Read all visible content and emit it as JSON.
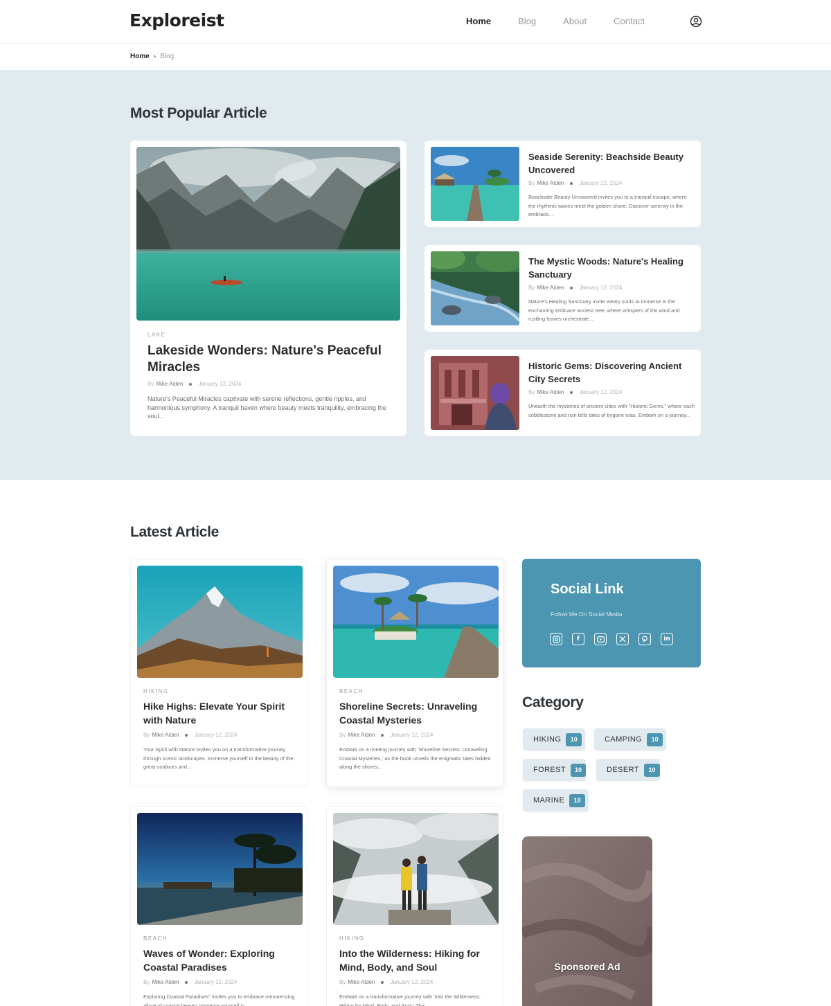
{
  "brand": {
    "logo": "Exploreist"
  },
  "nav": {
    "items": [
      "Home",
      "Blog",
      "About",
      "Contact"
    ],
    "active": "Home"
  },
  "header": {
    "user_icon": "user-circle-icon"
  },
  "breadcrumb": {
    "home": "Home",
    "separator": "›",
    "current": "Blog"
  },
  "popular": {
    "heading": "Most Popular Article",
    "featured": {
      "tag": "LAKE",
      "title": "Lakeside Wonders: Nature's Peaceful Miracles",
      "by": "By",
      "author": "Mike Aiden",
      "date": "January 12, 2024",
      "excerpt": "Nature's Peaceful Miracles captivate with serene reflections, gentle ripples, and harmonious symphony. A tranquil haven where beauty meets tranquility, embracing the soul..."
    },
    "side": [
      {
        "title": "Seaside Serenity: Beachside Beauty Uncovered",
        "by": "By",
        "author": "Mike Aiden",
        "date": "January 12, 2024",
        "excerpt": "Beachside Beauty Uncovered invites you to a tranquil escape, where the rhythmic waves meet the golden shore. Discover serenity in the embrace..."
      },
      {
        "title": "The Mystic Woods: Nature's Healing Sanctuary",
        "by": "By",
        "author": "Mike Aiden",
        "date": "January 12, 2024",
        "excerpt": "Nature's Healing Sanctuary invite weary souls to immerse in the enchanting embrace ancient tree, where whispers of the wind and rustling leaves orchestrate..."
      },
      {
        "title": "Historic Gems: Discovering Ancient City Secrets",
        "by": "By",
        "author": "Mike Aiden",
        "date": "January 12, 2024",
        "excerpt": "Unearth the mysteries of ancient cities with \"Historic Gems,\" where each cobblestone and ruin tells tales of bygone eras. Embark on a journey..."
      }
    ]
  },
  "latest": {
    "heading": "Latest Article",
    "articles": [
      {
        "tag": "HIKING",
        "title": "Hike Highs: Elevate Your Spirit with Nature",
        "by": "By",
        "author": "Mike Aiden",
        "date": "January 12, 2024",
        "excerpt": "Your Spirit with Nature invites you on a transformative journey through scenic landscapes. Immerse yourself in the beauty of the great outdoors and..."
      },
      {
        "tag": "BEACH",
        "title": "Shoreline Secrets: Unraveling Coastal Mysteries",
        "by": "By",
        "author": "Mike Aiden",
        "date": "January 12, 2024",
        "excerpt": "Embark on a riveting journey with 'Shoreline Secrets: Unraveling Coastal Mysteries,' as the book unveils the enigmatic tales hidden along the shores..."
      },
      {
        "tag": "BEACH",
        "title": "Waves of Wonder: Exploring Coastal Paradises",
        "by": "By",
        "author": "Mike Aiden",
        "date": "January 12, 2024",
        "excerpt": "Exploring Coastal Paradises\" invites you to embrace mesmerizing allure of coastal beauty. Immerse yourself in"
      },
      {
        "tag": "HIKING",
        "title": "Into the Wilderness: Hiking for Mind, Body, and Soul",
        "by": "By",
        "author": "Mike Aiden",
        "date": "January 12, 2024",
        "excerpt": "Embark on a transformative journey with 'Into the Wilderness: Hiking for Mind, Body, and Soul.' This"
      }
    ]
  },
  "social": {
    "title": "Social Link",
    "subtitle": "Follow Me On Social Media",
    "icons": [
      "instagram-icon",
      "facebook-icon",
      "youtube-icon",
      "x-icon",
      "pinterest-icon",
      "linkedin-icon"
    ]
  },
  "category": {
    "heading": "Category",
    "items": [
      {
        "label": "HIKING",
        "count": "10"
      },
      {
        "label": "CAMPING",
        "count": "10"
      },
      {
        "label": "FOREST",
        "count": "10"
      },
      {
        "label": "DESERT",
        "count": "10"
      },
      {
        "label": "MARINE",
        "count": "10"
      }
    ]
  },
  "ad": {
    "label": "Sponsored Ad"
  },
  "colors": {
    "accent": "#4c96b2",
    "popular_bg": "#e1eaef",
    "heading": "#2f3438"
  }
}
